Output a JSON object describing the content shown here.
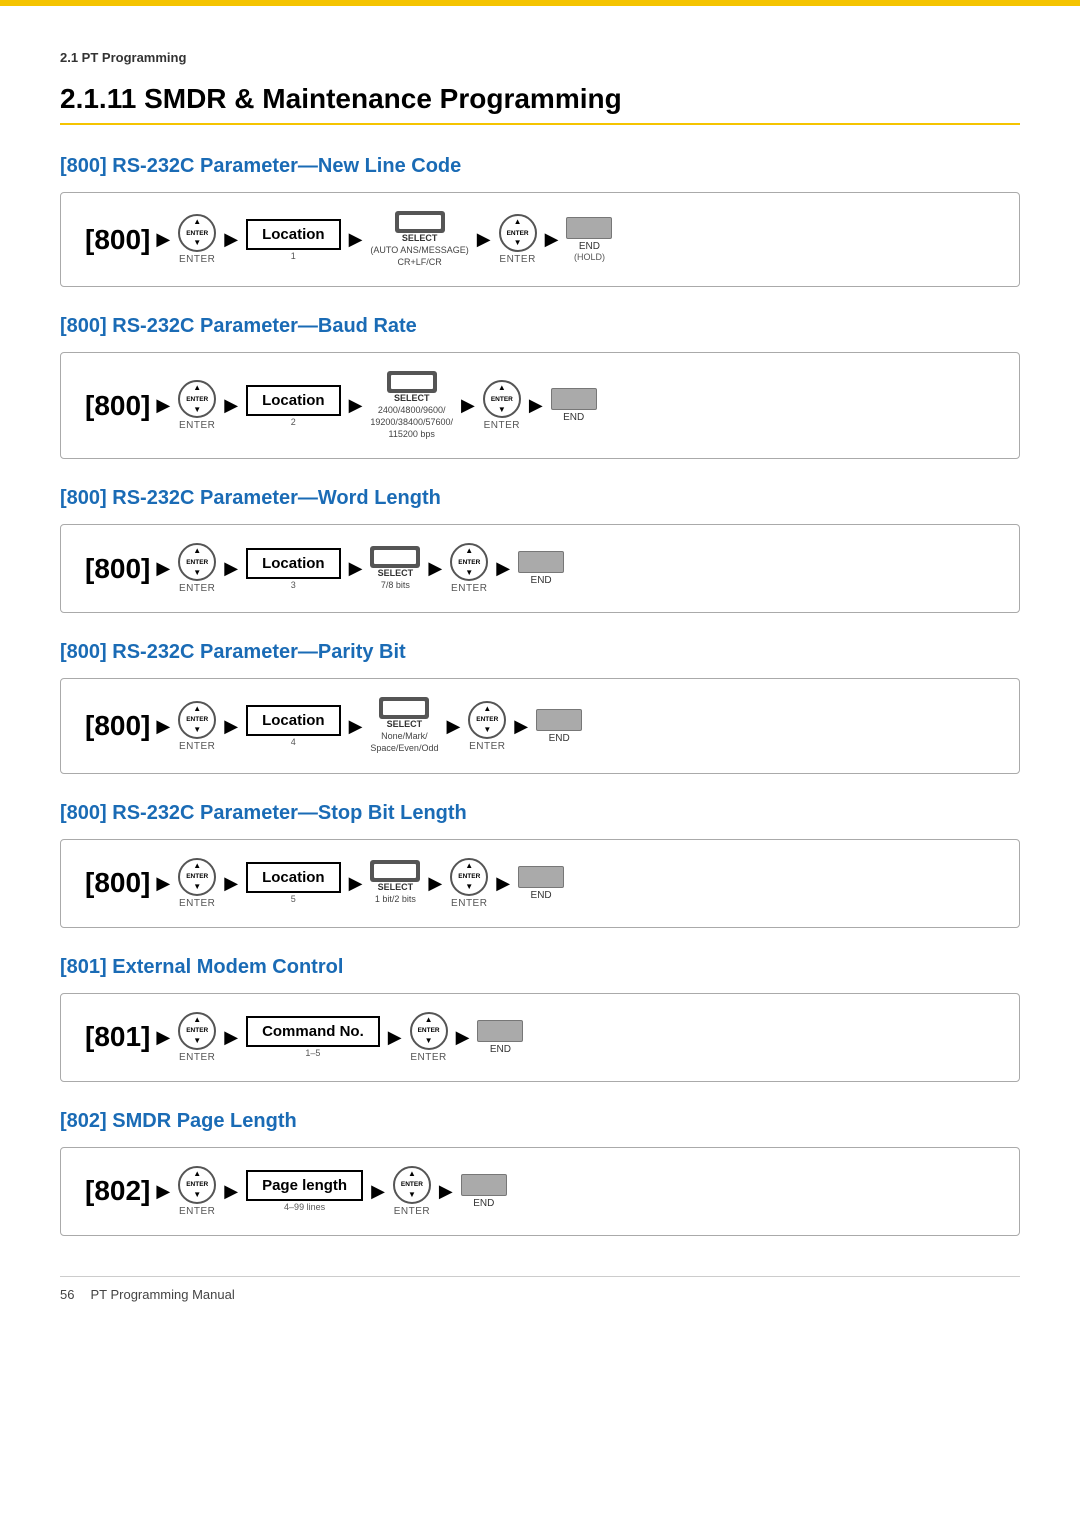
{
  "page": {
    "top_bar_color": "#f5c400",
    "breadcrumb": "2.1 PT Programming",
    "title": "2.1.11  SMDR & Maintenance Programming",
    "footer_page": "56",
    "footer_text": "PT Programming Manual"
  },
  "sections": [
    {
      "id": "s800-new-line",
      "title": "[800] RS-232C Parameter—New Line Code",
      "steps": [
        {
          "type": "key",
          "label": "[800]"
        },
        {
          "type": "arrow"
        },
        {
          "type": "enter",
          "label": "ENTER"
        },
        {
          "type": "arrow"
        },
        {
          "type": "location",
          "label": "Location",
          "sub": "1"
        },
        {
          "type": "arrow"
        },
        {
          "type": "select",
          "label": "SELECT",
          "sub": "(AUTO ANS/MESSAGE)\nCR+LF/CR"
        },
        {
          "type": "arrow"
        },
        {
          "type": "enter",
          "label": "ENTER"
        },
        {
          "type": "arrow"
        },
        {
          "type": "end",
          "label": "END",
          "sub": "(HOLD)"
        }
      ]
    },
    {
      "id": "s800-baud-rate",
      "title": "[800] RS-232C Parameter—Baud Rate",
      "steps": [
        {
          "type": "key",
          "label": "[800]"
        },
        {
          "type": "arrow"
        },
        {
          "type": "enter",
          "label": "ENTER"
        },
        {
          "type": "arrow"
        },
        {
          "type": "location",
          "label": "Location",
          "sub": "2"
        },
        {
          "type": "arrow"
        },
        {
          "type": "select",
          "label": "SELECT",
          "sub": "2400/4800/9600/\n19200/38400/57600/\n115200 bps"
        },
        {
          "type": "arrow"
        },
        {
          "type": "enter",
          "label": "ENTER"
        },
        {
          "type": "arrow"
        },
        {
          "type": "end",
          "label": "END",
          "sub": ""
        }
      ]
    },
    {
      "id": "s800-word-length",
      "title": "[800] RS-232C Parameter—Word Length",
      "steps": [
        {
          "type": "key",
          "label": "[800]"
        },
        {
          "type": "arrow"
        },
        {
          "type": "enter",
          "label": "ENTER"
        },
        {
          "type": "arrow"
        },
        {
          "type": "location",
          "label": "Location",
          "sub": "3"
        },
        {
          "type": "arrow"
        },
        {
          "type": "select",
          "label": "SELECT",
          "sub": "7/8 bits"
        },
        {
          "type": "arrow"
        },
        {
          "type": "enter",
          "label": "ENTER"
        },
        {
          "type": "arrow"
        },
        {
          "type": "end",
          "label": "END",
          "sub": ""
        }
      ]
    },
    {
      "id": "s800-parity-bit",
      "title": "[800] RS-232C Parameter—Parity Bit",
      "steps": [
        {
          "type": "key",
          "label": "[800]"
        },
        {
          "type": "arrow"
        },
        {
          "type": "enter",
          "label": "ENTER"
        },
        {
          "type": "arrow"
        },
        {
          "type": "location",
          "label": "Location",
          "sub": "4"
        },
        {
          "type": "arrow"
        },
        {
          "type": "select",
          "label": "SELECT",
          "sub": "None/Mark/\nSpace/Even/Odd"
        },
        {
          "type": "arrow"
        },
        {
          "type": "enter",
          "label": "ENTER"
        },
        {
          "type": "arrow"
        },
        {
          "type": "end",
          "label": "END",
          "sub": ""
        }
      ]
    },
    {
      "id": "s800-stop-bit",
      "title": "[800] RS-232C Parameter—Stop Bit Length",
      "steps": [
        {
          "type": "key",
          "label": "[800]"
        },
        {
          "type": "arrow"
        },
        {
          "type": "enter",
          "label": "ENTER"
        },
        {
          "type": "arrow"
        },
        {
          "type": "location",
          "label": "Location",
          "sub": "5"
        },
        {
          "type": "arrow"
        },
        {
          "type": "select",
          "label": "SELECT",
          "sub": "1 bit/2 bits"
        },
        {
          "type": "arrow"
        },
        {
          "type": "enter",
          "label": "ENTER"
        },
        {
          "type": "arrow"
        },
        {
          "type": "end",
          "label": "END",
          "sub": ""
        }
      ]
    },
    {
      "id": "s801-modem",
      "title": "[801] External Modem Control",
      "steps": [
        {
          "type": "key",
          "label": "[801]"
        },
        {
          "type": "arrow"
        },
        {
          "type": "enter",
          "label": "ENTER"
        },
        {
          "type": "arrow"
        },
        {
          "type": "command",
          "label": "Command No.",
          "sub": "1–5"
        },
        {
          "type": "arrow"
        },
        {
          "type": "enter",
          "label": "ENTER"
        },
        {
          "type": "arrow"
        },
        {
          "type": "end",
          "label": "END",
          "sub": ""
        }
      ]
    },
    {
      "id": "s802-smdr",
      "title": "[802] SMDR Page Length",
      "steps": [
        {
          "type": "key",
          "label": "[802]"
        },
        {
          "type": "arrow"
        },
        {
          "type": "enter",
          "label": "ENTER"
        },
        {
          "type": "arrow"
        },
        {
          "type": "pagelength",
          "label": "Page length",
          "sub": "4–99 lines"
        },
        {
          "type": "arrow"
        },
        {
          "type": "enter",
          "label": "ENTER"
        },
        {
          "type": "arrow"
        },
        {
          "type": "end",
          "label": "END",
          "sub": ""
        }
      ]
    }
  ]
}
